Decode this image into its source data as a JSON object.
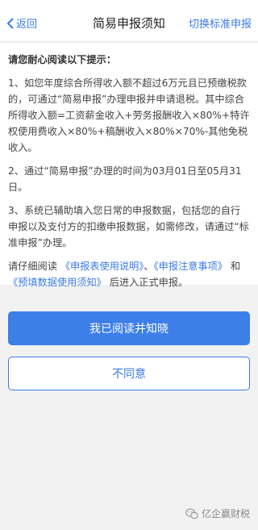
{
  "nav": {
    "back_label": "返回",
    "title": "简易申报须知",
    "right_action": "切换标准申报"
  },
  "content": {
    "intro": "请您耐心阅读以下提示：",
    "para1": "1、如您年度综合所得收入额不超过6万元且已预缴税款的，可通过“简易申报”办理申报并申请退税。其中综合所得收入额=工资薪金收入+劳务报酬收入×80%+特许权使用费收入×80%+稿酬收入×80%×70%-其他免税收入。",
    "para2": "2、通过“简易申报”办理的时间为03月01日至05月31日。",
    "para3": "3、系统已辅助填入您日常的申报数据，包括您的自行申报以及支付方的扣缴申报数据，如需修改，请通过“标准申报”办理。",
    "read_prefix": "请仔细阅读",
    "link1": "《申报表使用说明》",
    "sep1": "、",
    "link2": "《申报注意事项》",
    "and": "和",
    "link3": "《预填数据使用须知》",
    "read_suffix": "后进入正式申报。"
  },
  "buttons": {
    "agree": "我已阅读并知晓",
    "disagree": "不同意"
  },
  "watermark": {
    "text": "亿企赢财税",
    "icon": "wechat-icon"
  },
  "colors": {
    "accent": "#3b7be6",
    "primary_button": "#3d7fe8",
    "background": "#f2f2f2"
  }
}
